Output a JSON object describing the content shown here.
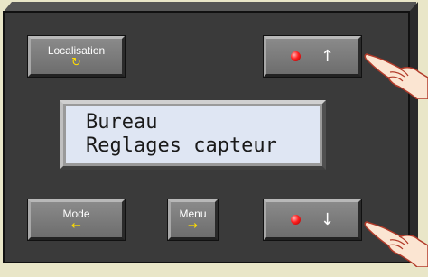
{
  "buttons": {
    "localisation": {
      "label": "Localisation",
      "icon": "refresh-icon",
      "symbol": "↻"
    },
    "mode": {
      "label": "Mode",
      "icon": "arrow-left-icon",
      "symbol": "←"
    },
    "menu": {
      "label": "Menu",
      "icon": "arrow-right-icon",
      "symbol": "→"
    },
    "up": {
      "icon": "arrow-up-icon",
      "symbol": "↑",
      "led": "red"
    },
    "down": {
      "icon": "arrow-down-icon",
      "symbol": "↓",
      "led": "red"
    }
  },
  "display": {
    "line1": "Bureau",
    "line2": "Reglages capteur"
  },
  "colors": {
    "background": "#e9e6c8",
    "panel": "#3a3a3a",
    "button": "#7a7a7a",
    "led": "#ff2020",
    "icon_accent": "#ffdd00",
    "lcd": "#dfe6f3"
  }
}
